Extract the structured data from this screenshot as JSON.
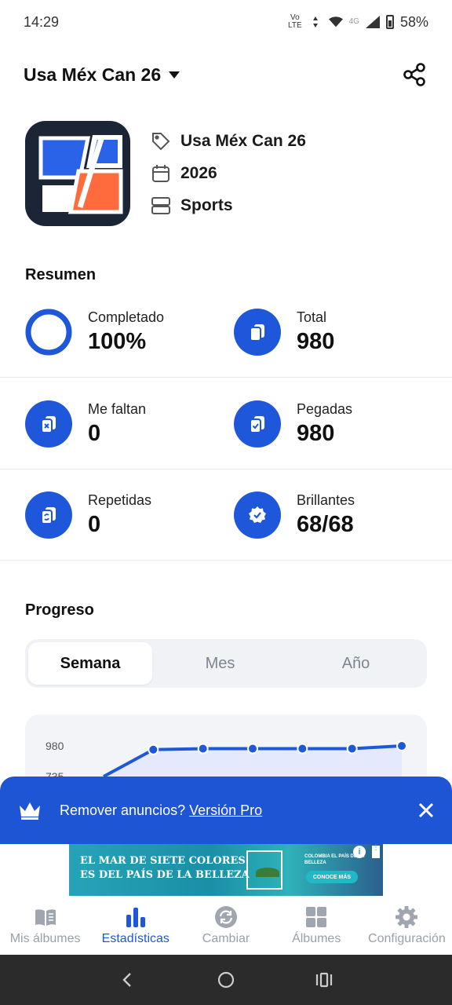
{
  "status_bar": {
    "time": "14:29",
    "volte_top": "Vo",
    "volte_bottom": "LTE",
    "network": "4G",
    "battery": "58%"
  },
  "header": {
    "album_name": "Usa Méx Can 26"
  },
  "album": {
    "name": "Usa Méx Can 26",
    "year": "2026",
    "category": "Sports"
  },
  "summary": {
    "title": "Resumen",
    "completed_label": "Completado",
    "completed_value": "100%",
    "completed_fraction": 1.0,
    "total_label": "Total",
    "total_value": "980",
    "missing_label": "Me faltan",
    "missing_value": "0",
    "stuck_label": "Pegadas",
    "stuck_value": "980",
    "repeated_label": "Repetidas",
    "repeated_value": "0",
    "shiny_label": "Brillantes",
    "shiny_value": "68/68"
  },
  "progress": {
    "title": "Progreso",
    "tabs": [
      "Semana",
      "Mes",
      "Año"
    ],
    "selected_tab": "Semana"
  },
  "chart_data": {
    "type": "line",
    "y_ticks": [
      "980",
      "735"
    ],
    "ylim": [
      735,
      980
    ],
    "values": [
      735,
      950,
      958,
      958,
      958,
      958,
      980
    ],
    "color": "#1e57d9"
  },
  "promo": {
    "text": "Remover anuncios? ",
    "link": "Versión Pro"
  },
  "ad": {
    "line1": "EL MAR DE SIETE COLORES",
    "line2": "ES DEL PAÍS DE LA BELLEZA",
    "brand": "COLOMBIA EL PAÍS DE LA BELLEZA",
    "button": "CONOCE MÁS"
  },
  "bottom_nav": {
    "items": [
      "Mis álbumes",
      "Estadísticas",
      "Cambiar",
      "Álbumes",
      "Configuración"
    ],
    "active": "Estadísticas"
  },
  "colors": {
    "accent": "#1e57d9",
    "promo_bg": "#1d55d4",
    "logo_bg": "#1b2536",
    "logo_orange": "#ff6b3d"
  }
}
